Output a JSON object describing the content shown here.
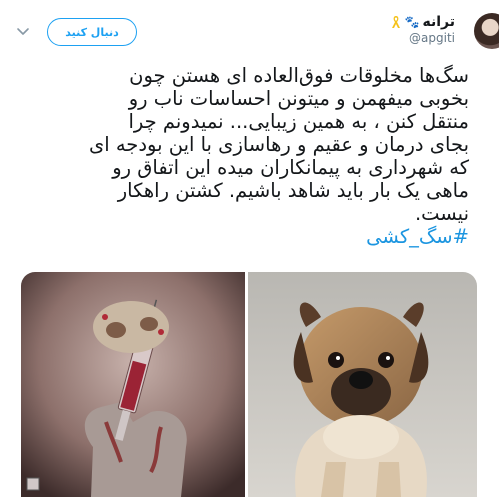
{
  "user": {
    "display_name": "ترانه",
    "handle": "@apgiti",
    "name_emoji": "paw-prints-icon",
    "badge_icon": "yellow-ribbon-icon"
  },
  "follow_button": {
    "label": "دنبال کنید"
  },
  "tweet": {
    "lines": [
      "سگ‌ها مخلوقات فوق‌العاده ای هستن چون",
      "بخوبی میفهمن و میتونن احساسات ناب رو",
      "منتقل کنن ، به همین زیبایی... نمیدونم چرا",
      "بجای درمان و عقیم و رهاسازی با این بودجه ای",
      "که شهرداری به پیمانکاران میده این اتفاق رو",
      "ماهی یک بار باید شاهد باشیم. کشتن راهکار",
      "نیست."
    ],
    "hashtag": "#سگ_کشی"
  },
  "colors": {
    "accent": "#1da1f2",
    "hashtag": "#1b95e0",
    "text": "#14171a",
    "muted": "#657786"
  },
  "media": {
    "left_image": "illustration-syringe-dog-hand",
    "right_image": "photo-puppy"
  }
}
